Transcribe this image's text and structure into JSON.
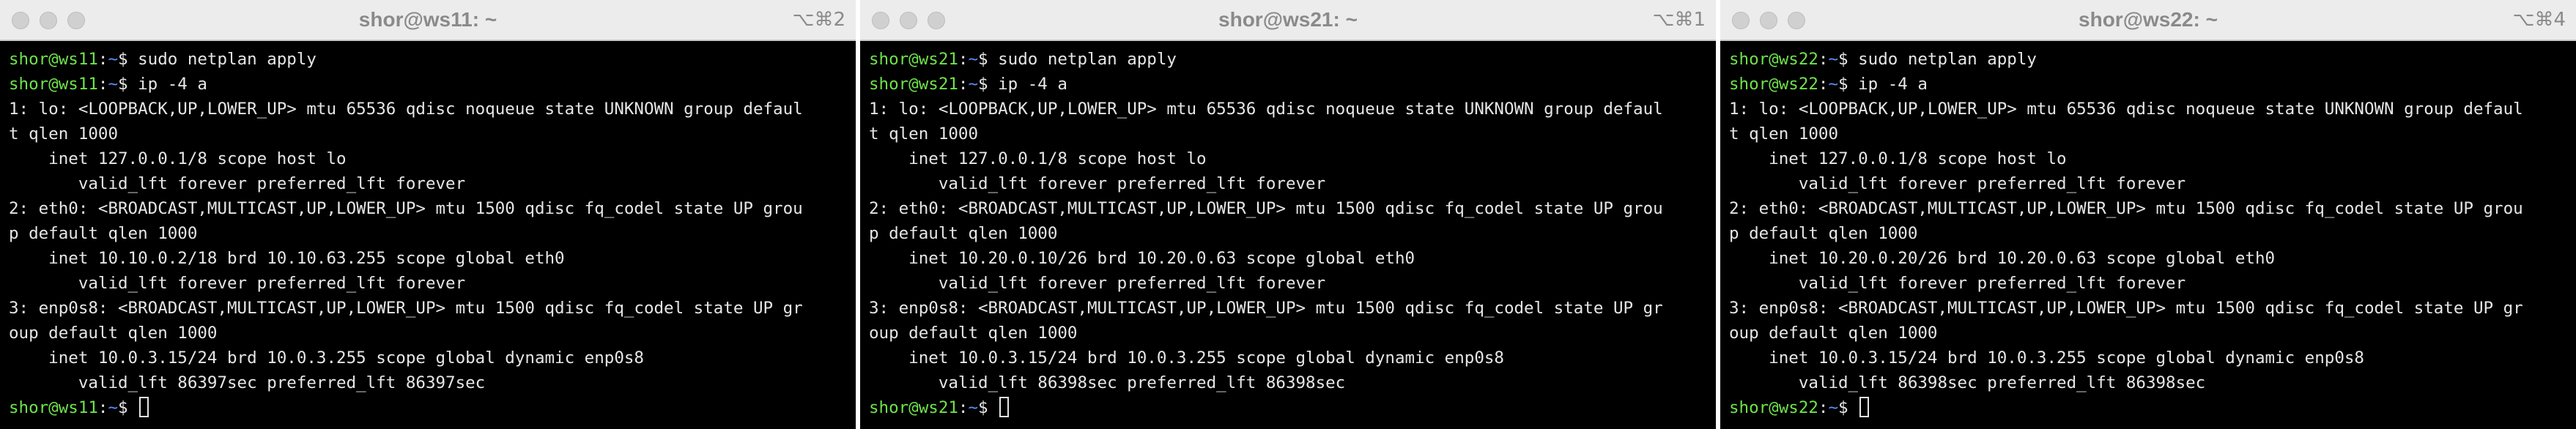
{
  "windows": [
    {
      "title": "shor@ws11: ~",
      "shortcut": "⌥⌘2",
      "user_host": "shor@ws11",
      "path": "~",
      "prompt_symbol": "$",
      "lines": [
        {
          "type": "prompt",
          "cmd": "sudo netplan apply"
        },
        {
          "type": "prompt",
          "cmd": "ip -4 a"
        },
        {
          "type": "out",
          "text": "1: lo: <LOOPBACK,UP,LOWER_UP> mtu 65536 qdisc noqueue state UNKNOWN group defaul"
        },
        {
          "type": "out",
          "text": "t qlen 1000"
        },
        {
          "type": "out",
          "text": "    inet 127.0.0.1/8 scope host lo"
        },
        {
          "type": "out",
          "text": "       valid_lft forever preferred_lft forever"
        },
        {
          "type": "out",
          "text": "2: eth0: <BROADCAST,MULTICAST,UP,LOWER_UP> mtu 1500 qdisc fq_codel state UP grou"
        },
        {
          "type": "out",
          "text": "p default qlen 1000"
        },
        {
          "type": "out",
          "text": "    inet 10.10.0.2/18 brd 10.10.63.255 scope global eth0"
        },
        {
          "type": "out",
          "text": "       valid_lft forever preferred_lft forever"
        },
        {
          "type": "out",
          "text": "3: enp0s8: <BROADCAST,MULTICAST,UP,LOWER_UP> mtu 1500 qdisc fq_codel state UP gr"
        },
        {
          "type": "out",
          "text": "oup default qlen 1000"
        },
        {
          "type": "out",
          "text": "    inet 10.0.3.15/24 brd 10.0.3.255 scope global dynamic enp0s8"
        },
        {
          "type": "out",
          "text": "       valid_lft 86397sec preferred_lft 86397sec"
        },
        {
          "type": "prompt",
          "cmd": "",
          "cursor": true
        }
      ]
    },
    {
      "title": "shor@ws21: ~",
      "shortcut": "⌥⌘1",
      "user_host": "shor@ws21",
      "path": "~",
      "prompt_symbol": "$",
      "lines": [
        {
          "type": "prompt",
          "cmd": "sudo netplan apply"
        },
        {
          "type": "prompt",
          "cmd": "ip -4 a"
        },
        {
          "type": "out",
          "text": "1: lo: <LOOPBACK,UP,LOWER_UP> mtu 65536 qdisc noqueue state UNKNOWN group defaul"
        },
        {
          "type": "out",
          "text": "t qlen 1000"
        },
        {
          "type": "out",
          "text": "    inet 127.0.0.1/8 scope host lo"
        },
        {
          "type": "out",
          "text": "       valid_lft forever preferred_lft forever"
        },
        {
          "type": "out",
          "text": "2: eth0: <BROADCAST,MULTICAST,UP,LOWER_UP> mtu 1500 qdisc fq_codel state UP grou"
        },
        {
          "type": "out",
          "text": "p default qlen 1000"
        },
        {
          "type": "out",
          "text": "    inet 10.20.0.10/26 brd 10.20.0.63 scope global eth0"
        },
        {
          "type": "out",
          "text": "       valid_lft forever preferred_lft forever"
        },
        {
          "type": "out",
          "text": "3: enp0s8: <BROADCAST,MULTICAST,UP,LOWER_UP> mtu 1500 qdisc fq_codel state UP gr"
        },
        {
          "type": "out",
          "text": "oup default qlen 1000"
        },
        {
          "type": "out",
          "text": "    inet 10.0.3.15/24 brd 10.0.3.255 scope global dynamic enp0s8"
        },
        {
          "type": "out",
          "text": "       valid_lft 86398sec preferred_lft 86398sec"
        },
        {
          "type": "prompt",
          "cmd": "",
          "cursor": true
        }
      ]
    },
    {
      "title": "shor@ws22: ~",
      "shortcut": "⌥⌘4",
      "user_host": "shor@ws22",
      "path": "~",
      "prompt_symbol": "$",
      "lines": [
        {
          "type": "prompt",
          "cmd": "sudo netplan apply"
        },
        {
          "type": "prompt",
          "cmd": "ip -4 a"
        },
        {
          "type": "out",
          "text": "1: lo: <LOOPBACK,UP,LOWER_UP> mtu 65536 qdisc noqueue state UNKNOWN group defaul"
        },
        {
          "type": "out",
          "text": "t qlen 1000"
        },
        {
          "type": "out",
          "text": "    inet 127.0.0.1/8 scope host lo"
        },
        {
          "type": "out",
          "text": "       valid_lft forever preferred_lft forever"
        },
        {
          "type": "out",
          "text": "2: eth0: <BROADCAST,MULTICAST,UP,LOWER_UP> mtu 1500 qdisc fq_codel state UP grou"
        },
        {
          "type": "out",
          "text": "p default qlen 1000"
        },
        {
          "type": "out",
          "text": "    inet 10.20.0.20/26 brd 10.20.0.63 scope global eth0"
        },
        {
          "type": "out",
          "text": "       valid_lft forever preferred_lft forever"
        },
        {
          "type": "out",
          "text": "3: enp0s8: <BROADCAST,MULTICAST,UP,LOWER_UP> mtu 1500 qdisc fq_codel state UP gr"
        },
        {
          "type": "out",
          "text": "oup default qlen 1000"
        },
        {
          "type": "out",
          "text": "    inet 10.0.3.15/24 brd 10.0.3.255 scope global dynamic enp0s8"
        },
        {
          "type": "out",
          "text": "       valid_lft 86398sec preferred_lft 86398sec"
        },
        {
          "type": "prompt",
          "cmd": "",
          "cursor": true
        }
      ]
    }
  ],
  "colors": {
    "terminal_bg": "#000000",
    "terminal_fg": "#e6e6e6",
    "prompt_user": "#6ee24a",
    "prompt_path": "#5c8cff",
    "titlebar_bg": "#ececec",
    "title_text": "#8a8a8a"
  },
  "icons": {
    "window_buttons": [
      "close-icon",
      "minimize-icon",
      "zoom-icon"
    ]
  }
}
